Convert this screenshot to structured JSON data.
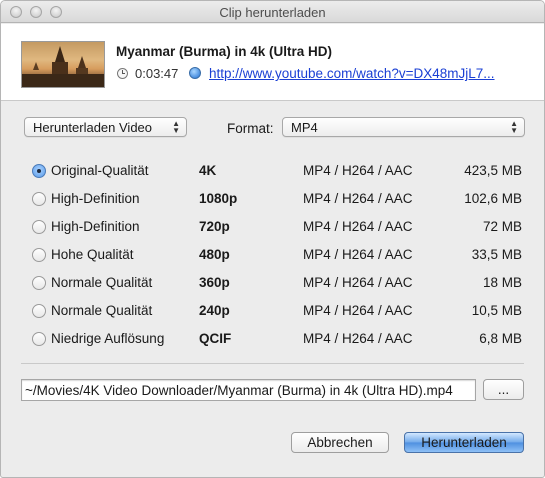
{
  "window": {
    "title": "Clip herunterladen"
  },
  "video": {
    "title": "Myanmar (Burma) in 4k (Ultra HD)",
    "duration": "0:03:47",
    "url": "http://www.youtube.com/watch?v=DX48mJjL7..."
  },
  "controls": {
    "download_type": "Herunterladen Video",
    "format_label": "Format:",
    "format_value": "MP4"
  },
  "qualities": [
    {
      "label": "Original-Qualität",
      "resolution": "4K",
      "codec": "MP4 / H264 / AAC",
      "size": "423,5 MB",
      "selected": true
    },
    {
      "label": "High-Definition",
      "resolution": "1080p",
      "codec": "MP4 / H264 / AAC",
      "size": "102,6 MB",
      "selected": false
    },
    {
      "label": "High-Definition",
      "resolution": "720p",
      "codec": "MP4 / H264 / AAC",
      "size": "72 MB",
      "selected": false
    },
    {
      "label": "Hohe Qualität",
      "resolution": "480p",
      "codec": "MP4 / H264 / AAC",
      "size": "33,5 MB",
      "selected": false
    },
    {
      "label": "Normale Qualität",
      "resolution": "360p",
      "codec": "MP4 / H264 / AAC",
      "size": "18 MB",
      "selected": false
    },
    {
      "label": "Normale Qualität",
      "resolution": "240p",
      "codec": "MP4 / H264 / AAC",
      "size": "10,5 MB",
      "selected": false
    },
    {
      "label": "Niedrige Auflösung",
      "resolution": "QCIF",
      "codec": "MP4 / H264 / AAC",
      "size": "6,8 MB",
      "selected": false
    }
  ],
  "save": {
    "path": "~/Movies/4K Video Downloader/Myanmar (Burma) in 4k (Ultra HD).mp4",
    "browse_label": "..."
  },
  "buttons": {
    "cancel": "Abbrechen",
    "download": "Herunterladen"
  },
  "icons": {
    "clock": "clock-icon",
    "globe": "globe-icon",
    "dropdown": "chevron-updown-icon"
  },
  "colors": {
    "link": "#1a3fd4",
    "primary_button": "#5a9be8"
  }
}
